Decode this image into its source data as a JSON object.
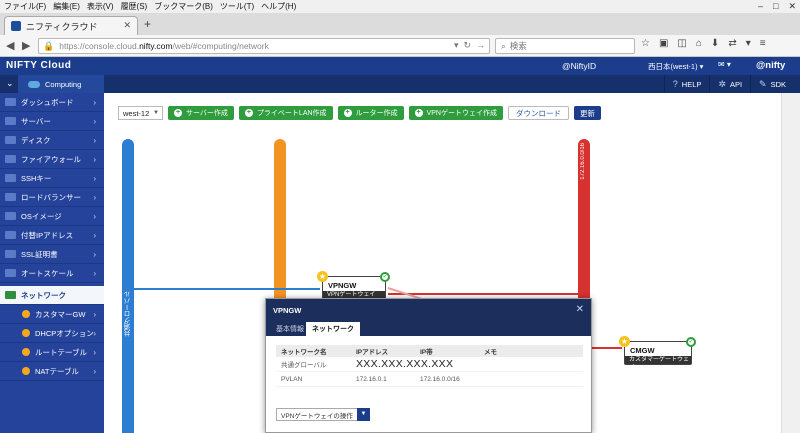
{
  "browser": {
    "menu": [
      "ファイル(F)",
      "編集(E)",
      "表示(V)",
      "履歴(S)",
      "ブックマーク(B)",
      "ツール(T)",
      "ヘルプ(H)"
    ],
    "tab_title": "ニフティクラウド",
    "url_prefix": "https://console.cloud.",
    "url_host": "nifty.com",
    "url_path": "/web/#computing/network",
    "search_placeholder": "検索"
  },
  "header": {
    "brand": "NIFTY Cloud",
    "user_id": "@NiftyID",
    "region": "西日本(west-1)",
    "nifty": "@nifty"
  },
  "subheader": {
    "computing": "Computing",
    "links": [
      {
        "label": "HELP",
        "icon": "?"
      },
      {
        "label": "API",
        "icon": "✲"
      },
      {
        "label": "SDK",
        "icon": "✎"
      }
    ]
  },
  "sidebar": {
    "items": [
      {
        "label": "ダッシュボード"
      },
      {
        "label": "サーバー"
      },
      {
        "label": "ディスク"
      },
      {
        "label": "ファイアウォール"
      },
      {
        "label": "SSHキー"
      },
      {
        "label": "ロードバランサー"
      },
      {
        "label": "OSイメージ"
      },
      {
        "label": "付替IPアドレス"
      },
      {
        "label": "SSL証明書"
      },
      {
        "label": "オートスケール"
      },
      {
        "label": "ネットワーク"
      },
      {
        "label": "カスタマーGW"
      },
      {
        "label": "DHCPオプション"
      },
      {
        "label": "ルートテーブル"
      },
      {
        "label": "NATテーブル"
      }
    ]
  },
  "toolbar": {
    "region_value": "west-12",
    "buttons": [
      "サーバー作成",
      "プライベートLAN作成",
      "ルーター作成",
      "VPNゲートウェイ作成"
    ],
    "download_label": "ダウンロード",
    "refresh_label": "更新"
  },
  "network_map": {
    "global_label": "共通グローバル",
    "private_cidr": "172.16.0.0/16",
    "vpn_node": {
      "name": "VPNGW",
      "type": "VPNゲートウェイ"
    },
    "cm_node": {
      "name": "CMGW",
      "type": "カスタマーゲートウェイ"
    }
  },
  "panel": {
    "title": "VPNGW",
    "tabs": [
      "基本情報",
      "ネットワーク"
    ],
    "columns": [
      "ネットワーク名",
      "IPアドレス",
      "IP帯",
      "メモ"
    ],
    "rows": [
      {
        "name": "共通グローバル",
        "ip": "XXX.XXX.XXX.XXX",
        "range": "",
        "memo": ""
      },
      {
        "name": "PVLAN",
        "ip": "172.16.0.1",
        "range": "172.16.0.0/16",
        "memo": ""
      }
    ],
    "operation_label": "VPNゲートウェイの操作"
  }
}
